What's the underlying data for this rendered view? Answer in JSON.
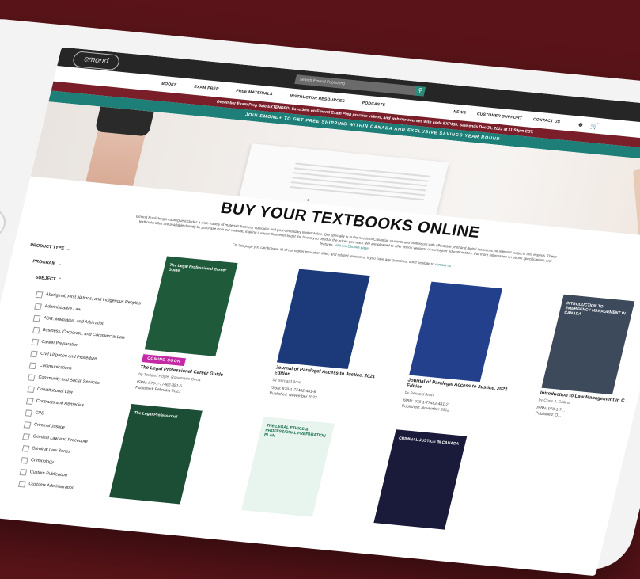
{
  "header": {
    "logo": "emond",
    "search_placeholder": "Search Emond Publishing",
    "nav": [
      "BOOKS",
      "EXAM PREP",
      "FREE MATERIALS",
      "INSTRUCTOR RESOURCES",
      "PODCASTS"
    ],
    "nav_right": [
      "NEWS",
      "CUSTOMER SUPPORT",
      "CONTACT US"
    ],
    "promo_sale": "December Exam Prep Sale EXTENDED! Save 30% on Emond Exam Prep practice videos, and webinar courses with code EXP130. Sale ends Dec 31, 2022 at 11:59pm EST.",
    "promo_shipping": "JOIN EMOND+ TO GET FREE SHIPPING WITHIN CANADA AND EXCLUSIVE SAVINGS YEAR ROUND"
  },
  "main": {
    "title": "BUY YOUR TEXTBOOKS ONLINE",
    "intro": "Emond Publishing's catalogue includes a wide variety of materials from our curricular and post-secondary textbook line. Our specialty is in the needs of Canadian students and professors with affordable print and digital resources on relevant subjects and experts. These textbooks titles are available directly by purchase from our website, making it easier than ever to get the books you need at the prices you want. We are pleased to offer ebook versions of our higher education titles. For more information on ebook specifications and features,",
    "intro_link_1": "visit our Ebooks page",
    "intro2": "On this page you can browse all of our higher education titles, and related resources. If you have any questions, don't hesitate to",
    "intro_link_2": "contact us"
  },
  "filters": {
    "product_type": "PRODUCT TYPE",
    "program": "PROGRAM",
    "subject": "SUBJECT",
    "subjects": [
      "Aboriginal, First Nations, and Indigenous Peoples",
      "Administrative Law",
      "ADR, Mediation, and Arbitration",
      "Business, Corporate, and Commercial Law",
      "Career Preparation",
      "Civil Litigation and Procedure",
      "Communications",
      "Community and Social Services",
      "Constitutional Law",
      "Contracts and Remedies",
      "CPD",
      "Criminal Justice",
      "Criminal Law and Procedure",
      "Criminal Law Series",
      "Criminology",
      "Custom Publication",
      "Customs Administration"
    ]
  },
  "books": [
    {
      "title": "The Legal Professional Career Guide",
      "author": "by Toriland Hoyle, Rosemarie Cena",
      "isbn": "ISBN: 978-1-77462-351-6",
      "pub": "Published: February 2023",
      "badge": "COMING SOON",
      "cover_color": "#1f5b3a",
      "cover_text": "The Legal Professional Career Guide"
    },
    {
      "title": "Journal of Paralegal Access to Justice, 2021 Edition",
      "author": "by Bernard Aron",
      "isbn": "ISBN: 978-1-77462-481-6",
      "pub": "Published: November 2022",
      "badge": "",
      "cover_color": "#1c3a7a",
      "cover_text": ""
    },
    {
      "title": "Journal of Paralegal Access to Justice, 2022 Edition",
      "author": "by Bernard Aron",
      "isbn": "ISBN: 978-1-77462-481-2",
      "pub": "Published: November 2022",
      "badge": "",
      "cover_color": "#23408c",
      "cover_text": ""
    },
    {
      "title": "Introduction to Law Management in C...",
      "author": "by Chris J. Collins",
      "isbn": "ISBN: 978-1-7...",
      "pub": "Published: O...",
      "badge": "",
      "cover_color": "#3c4a5c",
      "cover_text": "INTRODUCTION TO EMERGENCY MANAGEMENT IN CANADA"
    },
    {
      "title": "",
      "author": "",
      "isbn": "",
      "pub": "",
      "badge": "",
      "cover_color": "#1b4e34",
      "cover_text": "The Legal Professional"
    },
    {
      "title": "",
      "author": "",
      "isbn": "",
      "pub": "",
      "badge": "",
      "cover_color": "#e8f4ee",
      "cover_text": "THE LEGAL ETHICS & PROFESSIONAL PREPARATION PLAN"
    },
    {
      "title": "",
      "author": "",
      "isbn": "",
      "pub": "",
      "badge": "",
      "cover_color": "#1a1a3a",
      "cover_text": "CRIMINAL JUSTICE IN CANADA"
    }
  ]
}
